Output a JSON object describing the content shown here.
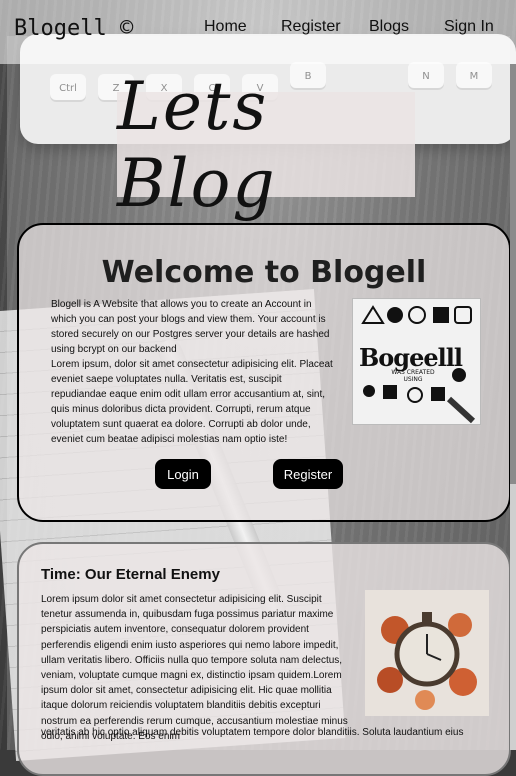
{
  "header": {
    "brand": "Blogell ©",
    "nav": [
      "Home",
      "Register",
      "Blogs",
      "Sign In"
    ]
  },
  "hero": {
    "text": "Lets Blog"
  },
  "keyboard": {
    "keys": [
      "Ctrl",
      "Z",
      "X",
      "C",
      "V",
      "B",
      "N",
      "M"
    ]
  },
  "welcome": {
    "title": "Welcome to Blogell",
    "paragraph1": "Blogell is A Website that allows you to create an Account in which you can post your blogs and view them. Your account is stored securely on our Postgres server your details are hashed using bcrypt on our backend",
    "paragraph2": "Lorem ipsum, dolor sit amet consectetur adipisicing elit. Placeat eveniet saepe voluptates nulla. Veritatis est, suscipit repudiandae eaque enim odit ullam error accusantium at, sint, quis minus doloribus dicta provident. Corrupti, rerum atque voluptatem sunt quaerat ea dolore. Corrupti ab dolor unde, eveniet cum beatae adipisci molestias nam optio iste!",
    "image_word": "Bogeelll",
    "image_caption": "WAS CREATED USING",
    "login_label": "Login",
    "register_label": "Register"
  },
  "blog": {
    "title": "Time: Our Eternal Enemy",
    "body_top": "Lorem ipsum dolor sit amet consectetur adipisicing elit. Suscipit tenetur assumenda in, quibusdam fuga possimus pariatur maxime perspiciatis autem inventore, consequatur dolorem provident perferendis eligendi enim iusto asperiores qui nemo labore impedit, ullam veritatis libero. Officiis nulla quo tempore soluta nam delectus, veniam, voluptate cumque magni ex, distinctio ipsam quidem.Lorem ipsum dolor sit amet, consectetur adipisicing elit. Hic quae mollitia itaque dolorum reiciendis voluptatem blanditiis debitis excepturi nostrum ea perferendis rerum cumque, accusantium molestiae minus odio, animi voluptate. Eos enim",
    "body_bottom": "veritatis ab hic optio aliquam debitis voluptatem tempore dolor blanditiis. Soluta laudantium eius"
  },
  "colors": {
    "button_bg": "#000000",
    "text": "#111111",
    "card_border": "#000000"
  }
}
